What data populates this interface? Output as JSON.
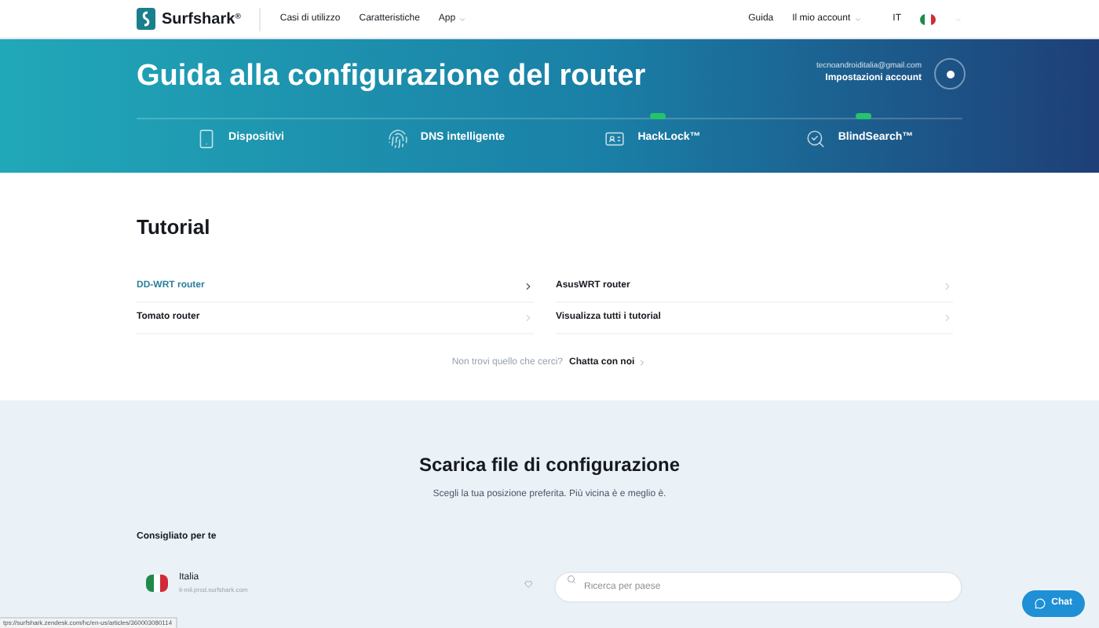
{
  "nav": {
    "brand": "Surfshark",
    "brand_mark": "®",
    "links": [
      {
        "label": "Casi di utilizzo",
        "dropdown": false
      },
      {
        "label": "Caratteristiche",
        "dropdown": false
      },
      {
        "label": "App",
        "dropdown": true
      }
    ],
    "right_links": [
      {
        "label": "Guida",
        "dropdown": false
      },
      {
        "label": "Il mio account",
        "dropdown": true
      }
    ],
    "language": "IT"
  },
  "hero": {
    "title": "Guida alla configurazione del router",
    "email": "tecnoandroiditalia@gmail.com",
    "account_link": "Impostazioni account",
    "features": [
      {
        "kind": "devices",
        "label": "Dispositivi",
        "badge": false
      },
      {
        "kind": "dns",
        "label": "DNS intelligente",
        "badge": false
      },
      {
        "kind": "hacklock",
        "label": "HackLock™",
        "badge": true
      },
      {
        "kind": "blindsearch",
        "label": "BlindSearch™",
        "badge": true
      }
    ]
  },
  "tutorial": {
    "title": "Tutorial",
    "items": [
      {
        "label": "DD-WRT router",
        "selected": true
      },
      {
        "label": "AsusWRT router",
        "selected": false
      },
      {
        "label": "Tomato router",
        "selected": false
      },
      {
        "label": "Visualizza tutti i tutorial",
        "selected": false
      }
    ],
    "help_text": "Non trovi quello che cerci?",
    "help_link": "Chatta con noi"
  },
  "download": {
    "title": "Scarica file di configurazione",
    "subtitle": "Scegli la tua posizione preferita. Più vicina è e meglio è.",
    "recommended_label": "Consigliato per te",
    "location": {
      "name": "Italia",
      "host": "it-mil.prod.surfshark.com"
    },
    "search": {
      "placeholder": "Ricerca per paese"
    }
  },
  "chat_button": "Chat",
  "status_bar": "tps://surfshark.zendesk.com/hc/en-us/articles/360003080114"
}
